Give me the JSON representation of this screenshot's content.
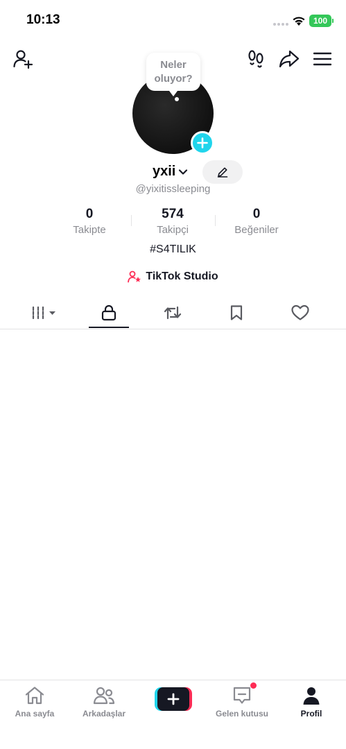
{
  "status_bar": {
    "time": "10:13",
    "battery": "100"
  },
  "top_bar": {
    "add_friend_icon": "person-plus-icon",
    "footprints_icon": "footprints-icon",
    "share_icon": "share-arrow-icon",
    "menu_icon": "hamburger-menu-icon"
  },
  "profile": {
    "bubble_line1": "Neler",
    "bubble_line2": "oluyor?",
    "username": "yxii",
    "handle": "@yixitissleeping",
    "bio": "#S4TILIK",
    "studio_label": "TikTok Studio"
  },
  "stats": [
    {
      "value": "0",
      "label": "Takipte"
    },
    {
      "value": "574",
      "label": "Takipçi"
    },
    {
      "value": "0",
      "label": "Beğeniler"
    }
  ],
  "tabs": [
    "videos-grid-icon",
    "lock-icon",
    "repost-icon",
    "bookmark-icon",
    "heart-icon"
  ],
  "active_tab": "lock-icon",
  "bottom_nav": [
    {
      "label": "Ana sayfa",
      "icon": "home-icon"
    },
    {
      "label": "Arkadaşlar",
      "icon": "friends-icon"
    },
    {
      "label": "",
      "icon": "create-plus-icon"
    },
    {
      "label": "Gelen kutusu",
      "icon": "inbox-icon"
    },
    {
      "label": "Profil",
      "icon": "profile-icon"
    }
  ],
  "colors": {
    "accent_cyan": "#20d5ec",
    "accent_red": "#fe2c55",
    "text_primary": "#161823",
    "text_secondary": "#8a8b91"
  }
}
